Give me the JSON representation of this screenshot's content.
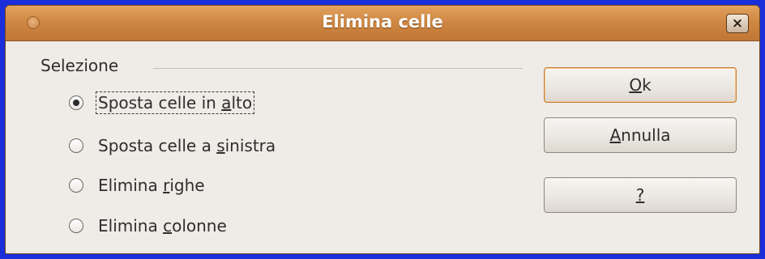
{
  "dialog": {
    "title": "Elimina celle",
    "close_glyph": "×"
  },
  "selection": {
    "group_label": "Selezione",
    "options": [
      {
        "pre": "Sposta celle in ",
        "mnemonic": "a",
        "post": "lto",
        "checked": true
      },
      {
        "pre": "Sposta celle a ",
        "mnemonic": "s",
        "post": "inistra",
        "checked": false
      },
      {
        "pre": "Elimina ",
        "mnemonic": "r",
        "post": "ighe",
        "checked": false
      },
      {
        "pre": "Elimina ",
        "mnemonic": "c",
        "post": "olonne",
        "checked": false
      }
    ]
  },
  "buttons": {
    "ok": {
      "pre": "",
      "mnemonic": "O",
      "post": "k"
    },
    "cancel": {
      "pre": "",
      "mnemonic": "A",
      "post": "nnulla"
    },
    "help": {
      "pre": "",
      "mnemonic": "?",
      "post": ""
    }
  },
  "colors": {
    "desktop": "#1a2edc",
    "titlebar": "#cf8843",
    "dialog_bg": "#efebe7",
    "default_button_border": "#c57f37"
  }
}
